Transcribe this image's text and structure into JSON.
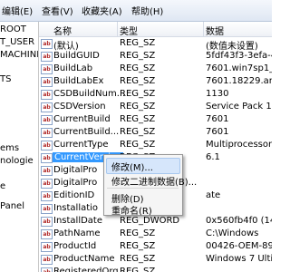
{
  "menu": [
    "编辑(E)",
    "查看(V)",
    "收藏夹(A)",
    "帮助(H)"
  ],
  "tree": [
    "ROOT",
    "T_USER",
    "MACHINI",
    "TS",
    "ems",
    "nologie",
    "e",
    "Panel"
  ],
  "columns": {
    "name": "名称",
    "type": "类型",
    "data": "数据"
  },
  "rows": [
    {
      "name": "(默认)",
      "type": "REG_SZ",
      "data": "(数值未设置)"
    },
    {
      "name": "BuildGUID",
      "type": "REG_SZ",
      "data": "5fdf43f3-3efa-44df-88f"
    },
    {
      "name": "BuildLab",
      "type": "REG_SZ",
      "data": "7601.win7sp1_gdr.1308"
    },
    {
      "name": "BuildLabEx",
      "type": "REG_SZ",
      "data": "7601.18229.amd64fre.w"
    },
    {
      "name": "CSDBuildNum...",
      "type": "REG_SZ",
      "data": "1130"
    },
    {
      "name": "CSDVersion",
      "type": "REG_SZ",
      "data": "Service Pack 1"
    },
    {
      "name": "CurrentBuild",
      "type": "REG_SZ",
      "data": "7601"
    },
    {
      "name": "CurrentBuild...",
      "type": "REG_SZ",
      "data": "7601"
    },
    {
      "name": "CurrentType",
      "type": "REG_SZ",
      "data": "Multiprocessor Free"
    },
    {
      "name": "CurrentVersion",
      "type": "REG_SZ",
      "data": "6.1"
    },
    {
      "name": "DigitalPro",
      "type": "",
      "data": ""
    },
    {
      "name": "DigitalPro",
      "type": "",
      "data": ""
    },
    {
      "name": "EditionID",
      "type": "",
      "data": "ate"
    },
    {
      "name": "Installatio",
      "type": "",
      "data": ""
    },
    {
      "name": "InstallDate",
      "type": "REG_DWORD",
      "data": "0x560fb4f0 (144389959"
    },
    {
      "name": "PathName",
      "type": "REG_SZ",
      "data": "C:\\Windows"
    },
    {
      "name": "ProductId",
      "type": "REG_SZ",
      "data": "00426-OEM-8992662-0"
    },
    {
      "name": "ProductName",
      "type": "REG_SZ",
      "data": "Windows 7 Ultimate"
    },
    {
      "name": "RegisteredOrg...",
      "type": "REG_SZ",
      "data": ""
    }
  ],
  "context_menu": [
    "修改(M)...",
    "修改二进制数据(B)...",
    "删除(D)",
    "重命名(R)"
  ]
}
